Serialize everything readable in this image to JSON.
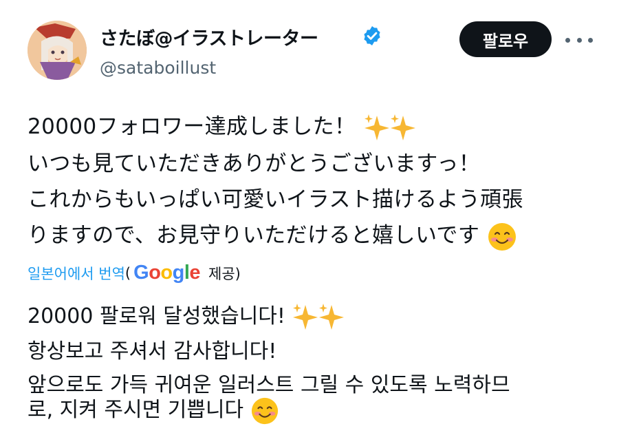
{
  "profile": {
    "display_name": "さたぼ@イラストレーター",
    "handle": "@sataboillust",
    "verified_icon": "verified-badge-icon",
    "avatar_icon": "avatar"
  },
  "actions": {
    "follow_label": "팔로우",
    "more_icon": "more-options-icon"
  },
  "post": {
    "lines": [
      "20000フォロワー達成しました！",
      "いつも見ていただきありがとうございますっ！",
      "これからもいっぱい可愛いイラスト描けるよう頑張",
      "りますので、お見守りいただけると嬉しいです"
    ]
  },
  "translation": {
    "link_label": "일본어에서 번역",
    "open_paren": "(",
    "provider": "Google",
    "provided_by": "제공)",
    "lines": [
      "20000 팔로워 달성했습니다!",
      "항상보고 주셔서 감사합니다!",
      "앞으로도 가득 귀여운 일러스트 그릴 수 있도록 노력하므",
      "로, 지켜 주시면 기쁩니다"
    ]
  },
  "colors": {
    "accent": "#1d9bf0",
    "text": "#0f1419",
    "secondary": "#536471",
    "google_blue": "#4285F4",
    "google_red": "#EA4335",
    "google_yellow": "#FBBC05",
    "google_green": "#34A853"
  }
}
